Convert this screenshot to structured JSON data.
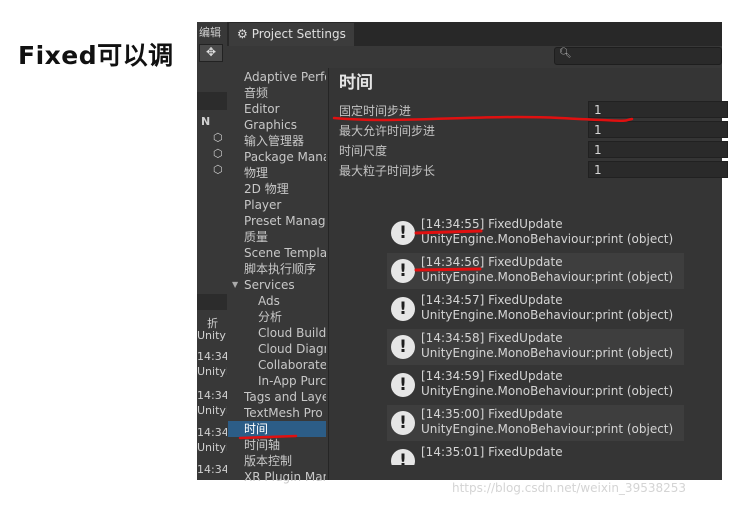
{
  "slide": {
    "heading": "Fixed可以调"
  },
  "left_strip": {
    "menu": "编辑",
    "rows": [
      "N",
      "折",
      "Unity",
      "14:34",
      "UnityE",
      "14:34",
      "UnityE",
      "14:34",
      "UnityE",
      "14:34"
    ]
  },
  "window": {
    "tab_title": "Project Settings",
    "tab_icon": "gear-icon",
    "search_icon": "search-icon"
  },
  "sidebar": {
    "items": [
      {
        "label": "Adaptive Perfo",
        "indent": 0
      },
      {
        "label": "音频",
        "indent": 0
      },
      {
        "label": "Editor",
        "indent": 0
      },
      {
        "label": "Graphics",
        "indent": 0
      },
      {
        "label": "输入管理器",
        "indent": 0
      },
      {
        "label": "Package Mana",
        "indent": 0
      },
      {
        "label": "物理",
        "indent": 0
      },
      {
        "label": "2D 物理",
        "indent": 0
      },
      {
        "label": "Player",
        "indent": 0
      },
      {
        "label": "Preset Manag",
        "indent": 0
      },
      {
        "label": "质量",
        "indent": 0
      },
      {
        "label": "Scene Templat",
        "indent": 0
      },
      {
        "label": "脚本执行顺序",
        "indent": 0
      },
      {
        "label": "Services",
        "indent": 0
      },
      {
        "label": "Ads",
        "indent": 1
      },
      {
        "label": "分析",
        "indent": 1
      },
      {
        "label": "Cloud Build",
        "indent": 1
      },
      {
        "label": "Cloud Diagn",
        "indent": 1
      },
      {
        "label": "Collaborate",
        "indent": 1
      },
      {
        "label": "In-App Purc",
        "indent": 1
      },
      {
        "label": "Tags and Laye",
        "indent": 0
      },
      {
        "label": "TextMesh Pro",
        "indent": 0
      },
      {
        "label": "时间",
        "indent": 0,
        "active": true
      },
      {
        "label": "时间轴",
        "indent": 0
      },
      {
        "label": "版本控制",
        "indent": 0
      },
      {
        "label": "XR Plugin Man",
        "indent": 0
      }
    ],
    "active_color": "#2c5d87"
  },
  "time_settings": {
    "title": "时间",
    "fields": [
      {
        "label": "固定时间步进",
        "value": "1"
      },
      {
        "label": "最大允许时间步进",
        "value": "1"
      },
      {
        "label": "时间尺度",
        "value": "1"
      },
      {
        "label": "最大粒子时间步长",
        "value": "1"
      }
    ]
  },
  "console": {
    "icon": "warning-icon",
    "entries": [
      {
        "line1": "[14:34:55] FixedUpdate",
        "line2": "UnityEngine.MonoBehaviour:print (object)"
      },
      {
        "line1": "[14:34:56] FixedUpdate",
        "line2": "UnityEngine.MonoBehaviour:print (object)"
      },
      {
        "line1": "[14:34:57] FixedUpdate",
        "line2": "UnityEngine.MonoBehaviour:print (object)"
      },
      {
        "line1": "[14:34:58] FixedUpdate",
        "line2": "UnityEngine.MonoBehaviour:print (object)"
      },
      {
        "line1": "[14:34:59] FixedUpdate",
        "line2": "UnityEngine.MonoBehaviour:print (object)"
      },
      {
        "line1": "[14:35:00] FixedUpdate",
        "line2": "UnityEngine.MonoBehaviour:print (object)"
      },
      {
        "line1": "[14:35:01] FixedUpdate",
        "line2": ""
      }
    ]
  },
  "annotation_color": "#e01010",
  "watermark": "https://blog.csdn.net/weixin_39538253"
}
